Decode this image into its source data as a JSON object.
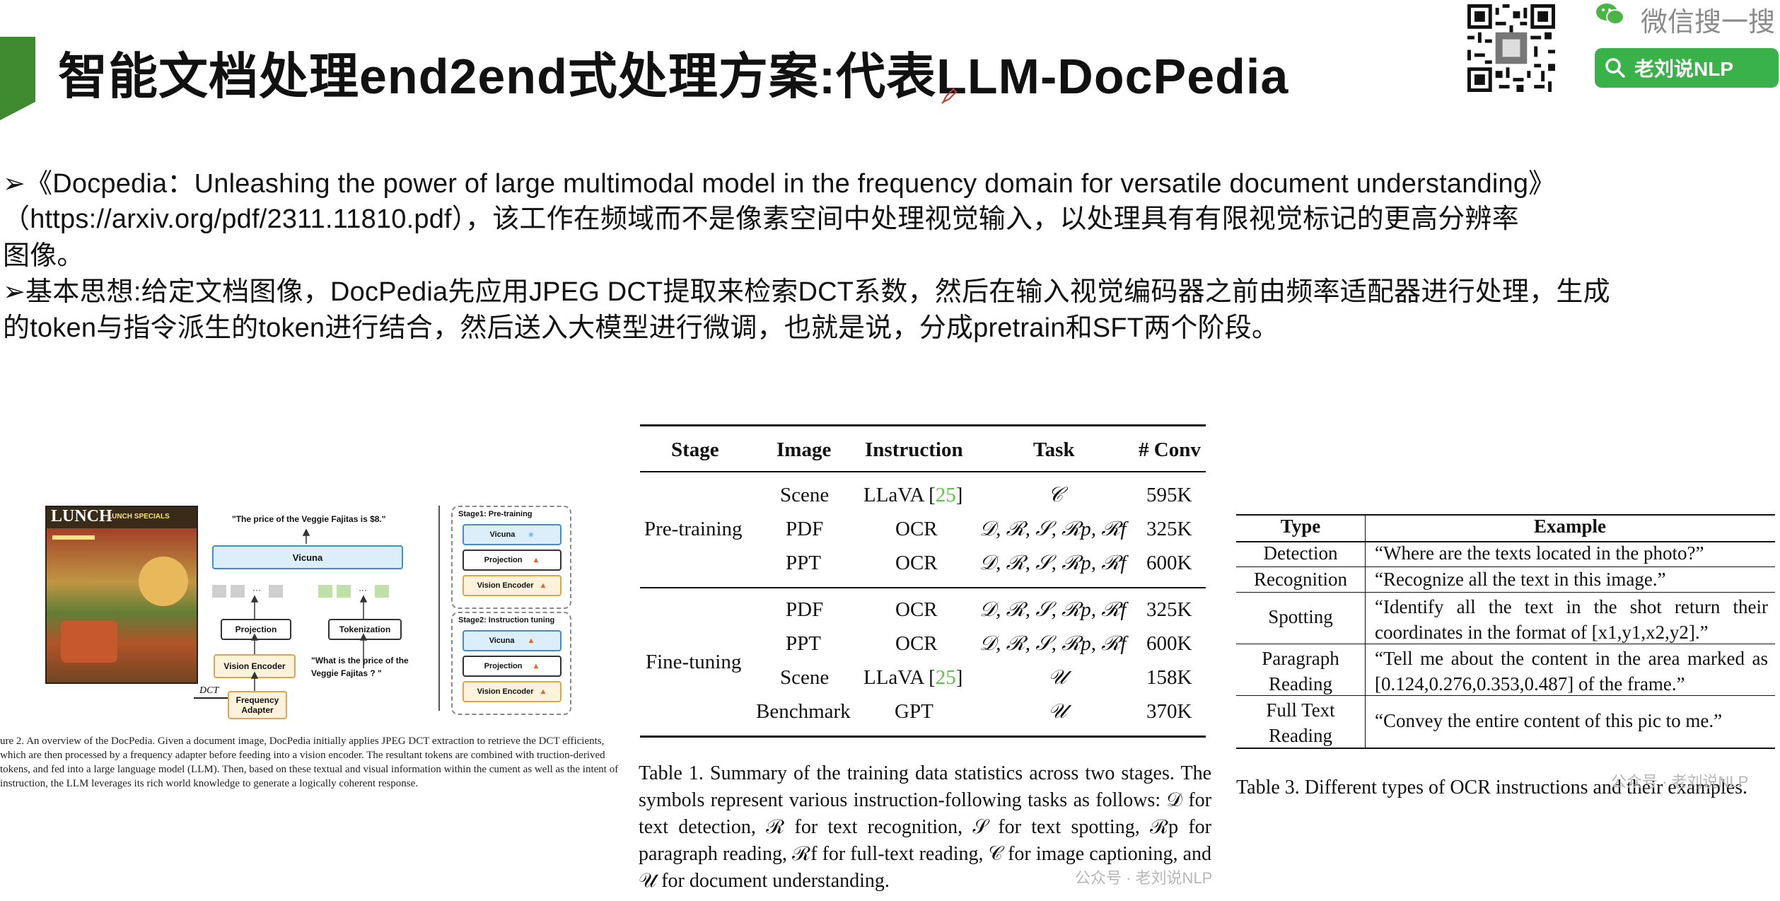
{
  "header": {
    "title": "智能文档处理end2end式处理方案:代表LLM-DocPedia",
    "wechat_search_text": "微信搜一搜",
    "search_button_label": "老刘说NLP"
  },
  "intro": {
    "line1": "➢《Docpedia：Unleashing the power of large multimodal model in the frequency domain for versatile document understanding》",
    "line2": "（https://arxiv.org/pdf/2311.11810.pdf），该工作在频域而不是像素空间中处理视觉输入，以处理具有有限视觉标记的更高分辨率",
    "line3": "图像。",
    "line4": "➢基本思想:给定文档图像，DocPedia先应用JPEG DCT提取来检索DCT系数，然后在输入视觉编码器之前由频率适配器进行处理，生成",
    "line5": "的token与指令派生的token进行结合，然后送入大模型进行微调，也就是说，分成pretrain和SFT两个阶段。"
  },
  "figure2": {
    "question": "\"The price of the Veggie Fajitas is $8.\"",
    "vicuna": "Vicuna",
    "projection": "Projection",
    "tokenization": "Tokenization",
    "vision_encoder": "Vision Encoder",
    "frequency_adapter": "Frequency Adapter",
    "dct": "DCT",
    "prompt": "\"What is the price of the Veggie Fajitas ? \"",
    "stage1": "Stage1: Pre-training",
    "stage2": "Stage2: Instruction tuning",
    "menu_title": "LUNCH",
    "menu_sub": "LUNCH SPECIALS",
    "caption": "ure 2. An overview of the DocPedia. Given a document image, DocPedia initially applies JPEG DCT extraction to retrieve the DCT efficients, which are then processed by a frequency adapter before feeding into a vision encoder. The resultant tokens are combined with truction-derived tokens, and fed into a large language model (LLM). Then, based on these textual and visual information within the cument as well as the intent of instruction, the LLM leverages its rich world knowledge to generate a logically coherent response."
  },
  "table1": {
    "headers": [
      "Stage",
      "Image",
      "Instruction",
      "Task",
      "# Conv"
    ],
    "rows": [
      {
        "stage": "Pre-training",
        "image": "Scene",
        "instruction": "LLaVA [",
        "cite": "25",
        "instruction_end": "]",
        "task": "𝒞",
        "conv": "595K"
      },
      {
        "stage": "",
        "image": "PDF",
        "instruction": "OCR",
        "cite": "",
        "instruction_end": "",
        "task": "𝒟, ℛ, 𝒮, ℛp, ℛf",
        "conv": "325K"
      },
      {
        "stage": "",
        "image": "PPT",
        "instruction": "OCR",
        "cite": "",
        "instruction_end": "",
        "task": "𝒟, ℛ, 𝒮, ℛp, ℛf",
        "conv": "600K"
      },
      {
        "stage": "Fine-tuning",
        "image": "PDF",
        "instruction": "OCR",
        "cite": "",
        "instruction_end": "",
        "task": "𝒟, ℛ, 𝒮, ℛp, ℛf",
        "conv": "325K"
      },
      {
        "stage": "",
        "image": "PPT",
        "instruction": "OCR",
        "cite": "",
        "instruction_end": "",
        "task": "𝒟, ℛ, 𝒮, ℛp, ℛf",
        "conv": "600K"
      },
      {
        "stage": "",
        "image": "Scene",
        "instruction": "LLaVA [",
        "cite": "25",
        "instruction_end": "]",
        "task": "𝒰",
        "conv": "158K"
      },
      {
        "stage": "",
        "image": "Benchmark",
        "instruction": "GPT",
        "cite": "",
        "instruction_end": "",
        "task": "𝒰",
        "conv": "370K"
      }
    ],
    "caption": "Table 1. Summary of the training data statistics across two stages. The symbols represent various instruction-following tasks as follows: 𝒟 for text detection, ℛ for text recognition, 𝒮 for text spotting, ℛp for paragraph reading, ℛf for full-text reading, 𝒞 for image captioning, and 𝒰 for document understanding."
  },
  "table3": {
    "headers": [
      "Type",
      "Example"
    ],
    "rows": [
      {
        "type": "Detection",
        "example": "“Where are the texts located in the photo?”"
      },
      {
        "type": "Recognition",
        "example": "“Recognize all the text in this image.”"
      },
      {
        "type": "Spotting",
        "example": "“Identify all the text in the shot return their coordinates in the format of [x1,y1,x2,y2].”"
      },
      {
        "type": "Paragraph Reading",
        "example": "“Tell me about the content in the area marked as [0.124,0.276,0.353,0.487] of the frame.”"
      },
      {
        "type": "Full Text Reading",
        "example": "“Convey the entire content of this pic to me.”"
      }
    ],
    "caption": "Table 3. Different types of OCR instructions and their examples."
  },
  "watermarks": {
    "wm1": "公众号 · 老刘说NLP",
    "wm2": "公众号 · 老刘说NLP"
  },
  "colors": {
    "accent_green": "#3f8a2e",
    "search_green": "#39b24a",
    "citation_green": "#5cc24b"
  }
}
